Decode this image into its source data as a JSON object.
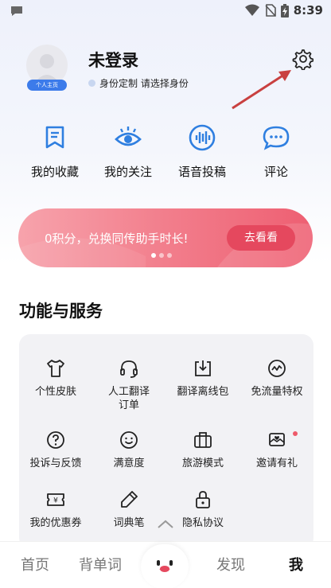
{
  "status_bar": {
    "time": "8:39"
  },
  "profile": {
    "badge": "个人主页",
    "username": "未登录",
    "subtitle": "身份定制 请选择身份"
  },
  "quick_actions": [
    {
      "label": "我的收藏",
      "icon": "bookmark-icon"
    },
    {
      "label": "我的关注",
      "icon": "eye-icon"
    },
    {
      "label": "语音投稿",
      "icon": "voice-icon"
    },
    {
      "label": "评论",
      "icon": "comment-icon"
    }
  ],
  "banner": {
    "text": "0积分，兑换同传助手时长!",
    "button": "去看看"
  },
  "services": {
    "title": "功能与服务",
    "items": [
      {
        "label": "个性皮肤",
        "icon": "tshirt-icon"
      },
      {
        "label": "人工翻译\n订单",
        "icon": "headset-icon"
      },
      {
        "label": "翻译离线包",
        "icon": "download-icon"
      },
      {
        "label": "免流量特权",
        "icon": "wave-icon"
      },
      {
        "label": "投诉与反馈",
        "icon": "question-icon"
      },
      {
        "label": "满意度",
        "icon": "smile-icon"
      },
      {
        "label": "旅游模式",
        "icon": "luggage-icon"
      },
      {
        "label": "邀请有礼",
        "icon": "invite-icon"
      },
      {
        "label": "我的优惠券",
        "icon": "coupon-icon"
      },
      {
        "label": "词典笔",
        "icon": "pen-icon"
      },
      {
        "label": "隐私协议",
        "icon": "lock-icon"
      }
    ]
  },
  "tabbar": {
    "tabs": [
      "首页",
      "背单词",
      "发现",
      "我"
    ],
    "active": "我"
  },
  "colors": {
    "accent": "#2f7fe0",
    "banner": "#f27e8c",
    "banner_button": "#e5485e",
    "arrow": "#c94040"
  }
}
